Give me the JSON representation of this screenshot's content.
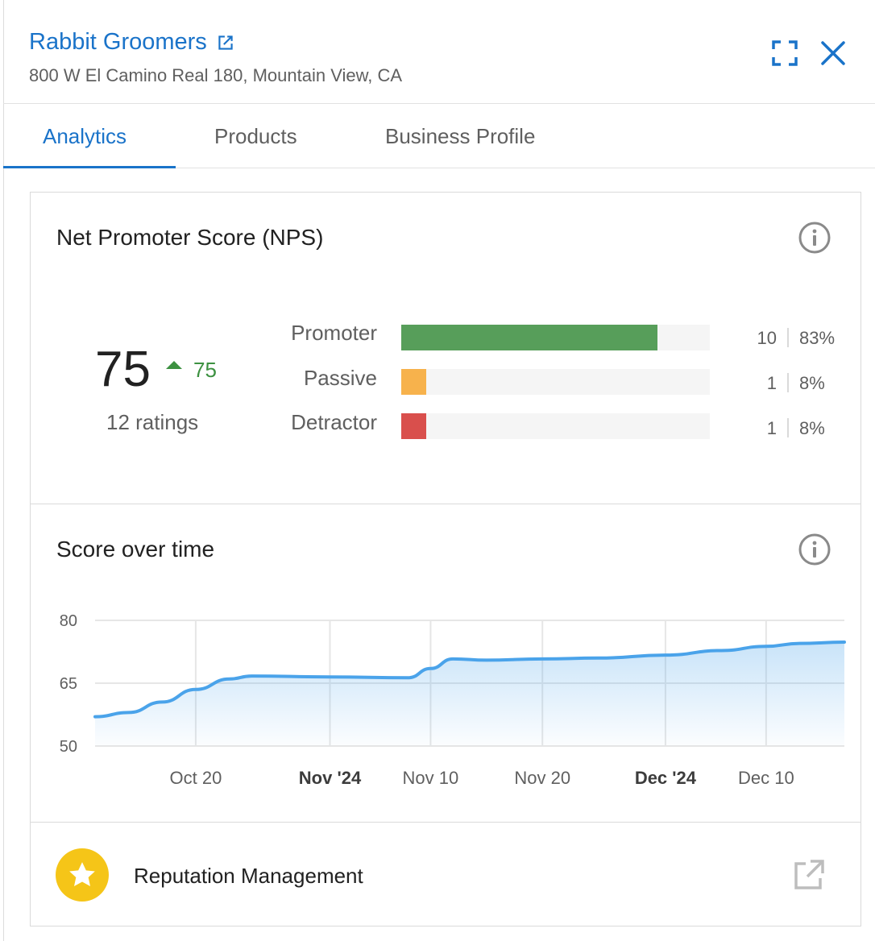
{
  "header": {
    "title": "Rabbit Groomers",
    "address": "800 W El Camino Real 180, Mountain View, CA",
    "icons": {
      "open": "external-link-icon",
      "expand": "expand-icon",
      "close": "close-icon"
    }
  },
  "tabs": [
    {
      "label": "Analytics",
      "active": true
    },
    {
      "label": "Products",
      "active": false
    },
    {
      "label": "Business Profile",
      "active": false
    }
  ],
  "nps": {
    "title": "Net Promoter Score (NPS)",
    "score": "75",
    "delta": "75",
    "ratings": "12 ratings",
    "rows": [
      {
        "label": "Promoter",
        "count": "10",
        "pct": "83%",
        "fraction": 0.83,
        "color": "#579e5a"
      },
      {
        "label": "Passive",
        "count": "1",
        "pct": "8%",
        "fraction": 0.08,
        "color": "#f7b24c"
      },
      {
        "label": "Detractor",
        "count": "1",
        "pct": "8%",
        "fraction": 0.08,
        "color": "#d94f4c"
      }
    ]
  },
  "score_over_time": {
    "title": "Score over time"
  },
  "chart_data": {
    "type": "area",
    "title": "Score over time",
    "y_ticks": [
      "80",
      "65",
      "50"
    ],
    "ylim": [
      50,
      80
    ],
    "x_ticks": [
      {
        "label": "Oct 20",
        "date": "2024-10-20",
        "bold": false
      },
      {
        "label": "Nov '24",
        "date": "2024-11-01",
        "bold": true
      },
      {
        "label": "Nov 10",
        "date": "2024-11-10",
        "bold": false
      },
      {
        "label": "Nov 20",
        "date": "2024-11-20",
        "bold": false
      },
      {
        "label": "Dec '24",
        "date": "2024-12-01",
        "bold": true
      },
      {
        "label": "Dec 10",
        "date": "2024-12-10",
        "bold": false
      }
    ],
    "xlim": [
      "2024-10-11",
      "2024-12-17"
    ],
    "grid": true,
    "series": [
      {
        "color": "#4aa3ea",
        "points": [
          [
            "2024-10-11",
            57
          ],
          [
            "2024-10-14",
            58
          ],
          [
            "2024-10-17",
            60.5
          ],
          [
            "2024-10-20",
            63.5
          ],
          [
            "2024-10-23",
            66
          ],
          [
            "2024-10-25",
            66.7
          ],
          [
            "2024-11-01",
            66.5
          ],
          [
            "2024-11-08",
            66.3
          ],
          [
            "2024-11-10",
            68.5
          ],
          [
            "2024-11-12",
            70.8
          ],
          [
            "2024-11-15",
            70.5
          ],
          [
            "2024-11-20",
            70.8
          ],
          [
            "2024-11-25",
            71
          ],
          [
            "2024-12-01",
            71.7
          ],
          [
            "2024-12-06",
            72.8
          ],
          [
            "2024-12-10",
            73.8
          ],
          [
            "2024-12-13",
            74.5
          ],
          [
            "2024-12-17",
            74.8
          ]
        ]
      }
    ]
  },
  "footer": {
    "label": "Reputation Management",
    "icons": {
      "badge": "star-icon",
      "open": "open-in-new-icon"
    }
  }
}
